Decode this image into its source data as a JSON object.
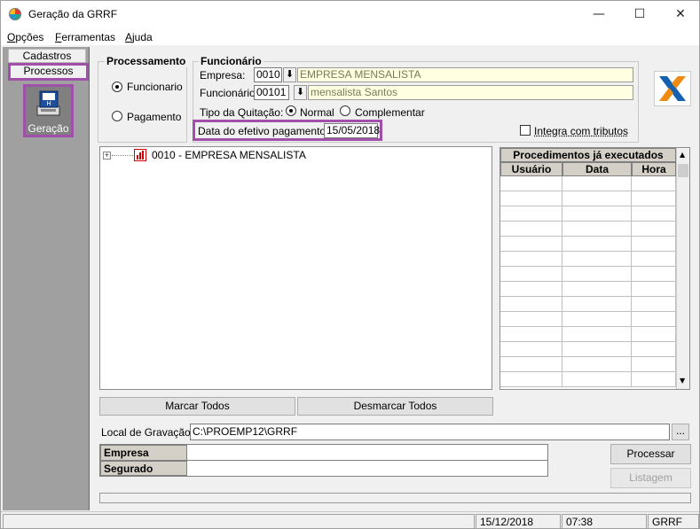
{
  "window": {
    "title": "Geração da GRRF",
    "minimize": "—",
    "maximize": "☐",
    "close": "✕"
  },
  "menu": [
    "Opções",
    "Ferramentas",
    "Ajuda"
  ],
  "left_panel": {
    "tab_cadastros": "Cadastros",
    "tab_processos": "Processos",
    "generation_label": "Geração"
  },
  "processamento": {
    "legend": "Processamento",
    "option_funcionario": "Funcionario",
    "option_pagamento": "Pagamento",
    "selected": "Funcionario"
  },
  "funcionario": {
    "legend": "Funcionário",
    "empresa_label": "Empresa:",
    "empresa_code": "0010",
    "empresa_name": "EMPRESA MENSALISTA",
    "funcionario_label": "Funcionário:",
    "funcionario_code": "00101",
    "funcionario_name": "mensalista Santos",
    "quitacao_label": "Tipo da Quitação:",
    "quitacao_normal": "Normal",
    "quitacao_complementar": "Complementar",
    "quitacao_selected": "Normal",
    "data_label": "Data do efetivo pagamento.:",
    "data_value": "15/05/2018"
  },
  "integra_label": "Integra com tributos",
  "integra_checked": false,
  "tree": {
    "expand_symbol": "+",
    "item": "0010 - EMPRESA MENSALISTA"
  },
  "procedimentos": {
    "title": "Procedimentos já executados",
    "columns": [
      "Usuário",
      "Data",
      "Hora"
    ],
    "rows": []
  },
  "buttons": {
    "marcar_todos": "Marcar Todos",
    "desmarcar_todos": "Desmarcar Todos",
    "browse": "...",
    "processar": "Processar",
    "listagem": "Listagem"
  },
  "local_gravacao": {
    "label": "Local de Gravação",
    "value": "C:\\PROEMP12\\GRRF"
  },
  "info": {
    "empresa_label": "Empresa",
    "empresa_value": "",
    "segurado_label": "Segurado",
    "segurado_value": ""
  },
  "status": {
    "date": "15/12/2018",
    "time": "07:38",
    "module": "GRRF"
  },
  "colors": {
    "highlight": "#a050a8",
    "readonly_field": "#ffffe1",
    "panel_gray": "#a0a0a0"
  }
}
